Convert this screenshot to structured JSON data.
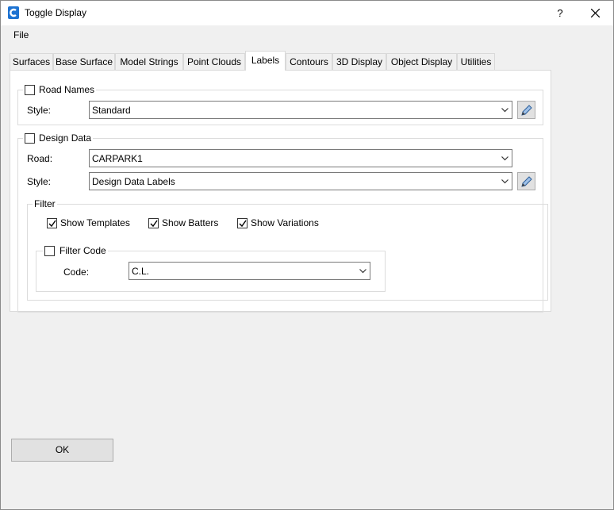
{
  "window": {
    "title": "Toggle Display",
    "help": "?",
    "close_icon": "close-icon"
  },
  "menu": {
    "file": "File"
  },
  "tabs": [
    "Surfaces",
    "Base Surface",
    "Model Strings",
    "Point Clouds",
    "Labels",
    "Contours",
    "3D Display",
    "Object Display",
    "Utilities"
  ],
  "active_tab": "Labels",
  "road_names": {
    "label": "Road Names",
    "checked": false,
    "style_label": "Style:",
    "style_value": "Standard"
  },
  "design_data": {
    "label": "Design Data",
    "checked": false,
    "road_label": "Road:",
    "road_value": "CARPARK1",
    "style_label": "Style:",
    "style_value": "Design Data Labels",
    "filter": {
      "label": "Filter",
      "show_templates": {
        "label": "Show Templates",
        "checked": true
      },
      "show_batters": {
        "label": "Show Batters",
        "checked": true
      },
      "show_variations": {
        "label": "Show Variations",
        "checked": true
      },
      "filter_code": {
        "label": "Filter Code",
        "checked": false,
        "code_label": "Code:",
        "code_value": "C.L."
      }
    }
  },
  "ok_button": "OK"
}
